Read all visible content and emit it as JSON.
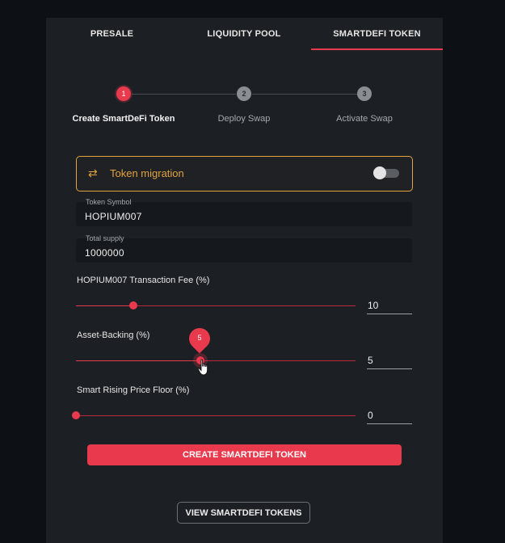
{
  "tabs": [
    {
      "label": "PRESALE"
    },
    {
      "label": "LIQUIDITY POOL"
    },
    {
      "label": "SMARTDEFI TOKEN",
      "active": true
    }
  ],
  "steps": [
    {
      "num": "1",
      "label": "Create SmartDeFi Token",
      "active": true
    },
    {
      "num": "2",
      "label": "Deploy Swap"
    },
    {
      "num": "3",
      "label": "Activate Swap"
    }
  ],
  "migration": {
    "label": "Token migration",
    "enabled": false,
    "icon": "swap-arrows-icon"
  },
  "fields": {
    "symbol": {
      "label": "Token Symbol",
      "value": "HOPIUM007"
    },
    "supply": {
      "label": "Total supply",
      "value": "1000000"
    }
  },
  "sliders": {
    "fee": {
      "label": "HOPIUM007 Transaction Fee (%)",
      "value": "10",
      "fraction": 0.2
    },
    "backing": {
      "label": "Asset-Backing (%)",
      "value": "5",
      "tooltip": "5",
      "fraction": 0.45
    },
    "floor": {
      "label": "Smart Rising Price Floor (%)",
      "value": "0",
      "fraction": 0
    }
  },
  "buttons": {
    "create": "CREATE SMARTDEFI TOKEN",
    "view": "VIEW SMARTDEFI TOKENS"
  },
  "colors": {
    "accent": "#e8394d",
    "warning": "#e2a33c",
    "panel": "#1c1f24",
    "background": "#0d1116"
  }
}
